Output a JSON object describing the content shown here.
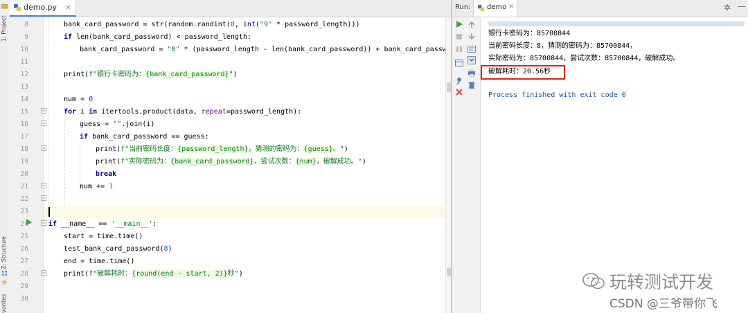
{
  "side_panel": {
    "project_label": "1: Project",
    "structure_label": "Z: Structure",
    "favorites_label": "vorites"
  },
  "editor": {
    "tab_label": "demo.py",
    "tab_close": "×",
    "line_numbers": [
      "8",
      "9",
      "10",
      "11",
      "12",
      "13",
      "14",
      "15",
      "16",
      "17",
      "18",
      "19",
      "20",
      "21",
      "22",
      "23",
      "24",
      "25",
      "26",
      "27",
      "28",
      "29",
      "30"
    ],
    "lines": {
      "l8": [
        "bank_card_password = str(random.randint(",
        "0",
        ", ",
        "int",
        "(",
        "\"9\"",
        " * password_length)))"
      ],
      "l9": [
        "if",
        " len(bank_card_password) < password_length:"
      ],
      "l10": [
        "bank_card_password = ",
        "\"0\"",
        " * (password_length - len(bank_card_password)) + bank_card_password"
      ],
      "l12": [
        "print(",
        "f\"银行卡密码为：",
        "{bank_card_password}",
        "\"",
        ")"
      ],
      "l14": [
        "num = ",
        "0"
      ],
      "l15": [
        "for",
        " i ",
        "in",
        " itertools.product(data, ",
        "repeat",
        "=password_length):"
      ],
      "l16": [
        "guess = ",
        "\"\"",
        ".join(i)"
      ],
      "l17": [
        "if",
        " bank_card_password == guess:"
      ],
      "l18": [
        "print(",
        "f\"当前密码长度：",
        "{password_length}",
        "，猜测的密码为：",
        "{guess}",
        "。\"",
        ")"
      ],
      "l19": [
        "print(",
        "f\"实际密码为：",
        "{bank_card_password}",
        "，尝试次数：",
        "{num}",
        "，破解成功。\"",
        ")"
      ],
      "l20": [
        "break"
      ],
      "l21": [
        "num += ",
        "1"
      ],
      "l24": [
        "if",
        " __name__ == ",
        "'__main__'",
        ":"
      ],
      "l25": [
        "start = time.time()"
      ],
      "l26": [
        "test_bank_card_password(",
        "8",
        ")"
      ],
      "l27": [
        "end = time.time()"
      ],
      "l28": [
        "print(",
        "f\"破解耗时：",
        "{round(end - start, 2)}",
        "秒\"",
        ")"
      ]
    }
  },
  "run_panel": {
    "label": "Run:",
    "tab_label": "demo",
    "tab_close": "×",
    "gear": "✲",
    "minimize": "—"
  },
  "console": {
    "output": [
      "银行卡密码为：85700844",
      "当前密码长度：8，猜测的密码为：85700844，",
      "实际密码为：85700844，尝试次数：85700844，破解成功。",
      "破解耗时：20.56秒"
    ],
    "exit_message": "Process finished with exit code 0"
  },
  "watermark": {
    "channel": "玩转测试开发",
    "credit": "CSDN @三爷带你飞"
  },
  "colors": {
    "keyword": "#000080",
    "string": "#067d17",
    "number": "#1750eb",
    "highlight_box": "#e02020"
  }
}
